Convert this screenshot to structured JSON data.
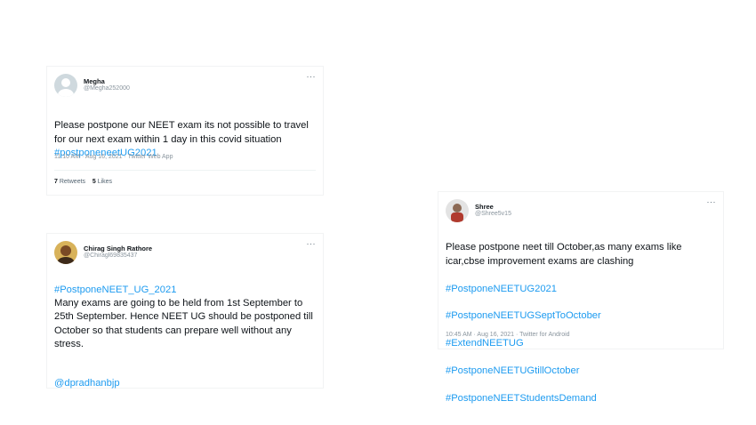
{
  "tweet1": {
    "display_name": "Megha",
    "handle": "@Megha252000",
    "more": "···",
    "text": "Please postpone our NEET exam its not possible to travel for our next exam within 1 day in this covid situation",
    "hashtag": "#postponeneetUG2021",
    "meta": "11:10 AM · Aug 16, 2021 · Twitter Web App",
    "retweets_count": "7",
    "retweets_label": "Retweets",
    "likes_count": "5",
    "likes_label": "Likes"
  },
  "tweet2": {
    "display_name": "Chirag Singh Rathore",
    "handle": "@Chiragl69835437",
    "more": "···",
    "hashtag": "#PostponeNEET_UG_2021",
    "text": "Many exams are going to be held from 1st September to 25th September.  Hence NEET UG should be postponed till October so that students can prepare well without any stress.",
    "mention": "@dpradhanbjp"
  },
  "tweet3": {
    "display_name": "Shree",
    "handle": "@Shree5v15",
    "more": "···",
    "text": "Please postpone neet till October,as many exams like icar,cbse improvement exams are clashing",
    "hashtags": [
      "#PostponeNEETUG2021",
      "#PostponeNEETUGSeptToOctober",
      "#ExtendNEETUG",
      "#PostponeNEETUGtillOctober",
      "#PostponeNEETStudentsDemand"
    ],
    "meta": "10:45 AM · Aug 16, 2021 · Twitter for Android"
  }
}
